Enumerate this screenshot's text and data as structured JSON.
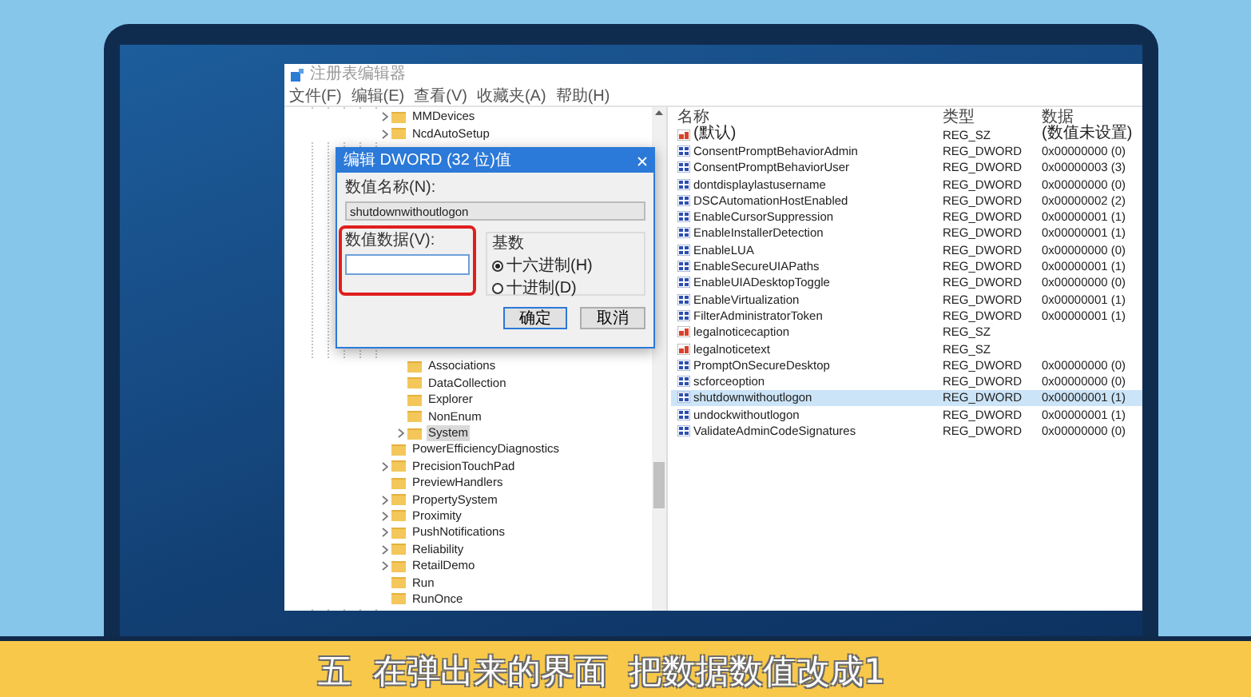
{
  "window": {
    "title": "注册表编辑器"
  },
  "menu": [
    "文件(F)",
    "编辑(E)",
    "查看(V)",
    "收藏夹(A)",
    "帮助(H)"
  ],
  "tree": {
    "items": [
      {
        "label": "MMDevices",
        "expandable": true,
        "selected": false
      },
      {
        "label": "NcdAutoSetup",
        "expandable": true,
        "selected": false
      },
      {
        "children": [
          {
            "label": "Associations",
            "expandable": false,
            "selected": false
          },
          {
            "label": "DataCollection",
            "expandable": false,
            "selected": false
          },
          {
            "label": "Explorer",
            "expandable": false,
            "selected": false
          },
          {
            "label": "NonEnum",
            "expandable": false,
            "selected": false
          },
          {
            "label": "System",
            "expandable": true,
            "selected": true
          }
        ]
      },
      {
        "label": "PowerEfficiencyDiagnostics",
        "expandable": false,
        "selected": false
      },
      {
        "label": "PrecisionTouchPad",
        "expandable": true,
        "selected": false
      },
      {
        "label": "PreviewHandlers",
        "expandable": false,
        "selected": false
      },
      {
        "label": "PropertySystem",
        "expandable": true,
        "selected": false
      },
      {
        "label": "Proximity",
        "expandable": true,
        "selected": false
      },
      {
        "label": "PushNotifications",
        "expandable": true,
        "selected": false
      },
      {
        "label": "Reliability",
        "expandable": true,
        "selected": false
      },
      {
        "label": "RetailDemo",
        "expandable": true,
        "selected": false
      },
      {
        "label": "Run",
        "expandable": false,
        "selected": false
      },
      {
        "label": "RunOnce",
        "expandable": false,
        "selected": false
      }
    ]
  },
  "values": {
    "columns": [
      "名称",
      "类型",
      "数据"
    ],
    "rows": [
      {
        "name": "(默认)",
        "kind": "sz",
        "type": "REG_SZ",
        "data": "(数值未设置)",
        "selected": false
      },
      {
        "name": "ConsentPromptBehaviorAdmin",
        "kind": "dword",
        "type": "REG_DWORD",
        "data": "0x00000000 (0)",
        "selected": false
      },
      {
        "name": "ConsentPromptBehaviorUser",
        "kind": "dword",
        "type": "REG_DWORD",
        "data": "0x00000003 (3)",
        "selected": false
      },
      {
        "name": "dontdisplaylastusername",
        "kind": "dword",
        "type": "REG_DWORD",
        "data": "0x00000000 (0)",
        "selected": false
      },
      {
        "name": "DSCAutomationHostEnabled",
        "kind": "dword",
        "type": "REG_DWORD",
        "data": "0x00000002 (2)",
        "selected": false
      },
      {
        "name": "EnableCursorSuppression",
        "kind": "dword",
        "type": "REG_DWORD",
        "data": "0x00000001 (1)",
        "selected": false
      },
      {
        "name": "EnableInstallerDetection",
        "kind": "dword",
        "type": "REG_DWORD",
        "data": "0x00000001 (1)",
        "selected": false
      },
      {
        "name": "EnableLUA",
        "kind": "dword",
        "type": "REG_DWORD",
        "data": "0x00000000 (0)",
        "selected": false
      },
      {
        "name": "EnableSecureUIAPaths",
        "kind": "dword",
        "type": "REG_DWORD",
        "data": "0x00000001 (1)",
        "selected": false
      },
      {
        "name": "EnableUIADesktopToggle",
        "kind": "dword",
        "type": "REG_DWORD",
        "data": "0x00000000 (0)",
        "selected": false
      },
      {
        "name": "EnableVirtualization",
        "kind": "dword",
        "type": "REG_DWORD",
        "data": "0x00000001 (1)",
        "selected": false
      },
      {
        "name": "FilterAdministratorToken",
        "kind": "dword",
        "type": "REG_DWORD",
        "data": "0x00000001 (1)",
        "selected": false
      },
      {
        "name": "legalnoticecaption",
        "kind": "sz",
        "type": "REG_SZ",
        "selected": false
      },
      {
        "name": "legalnoticetext",
        "kind": "sz",
        "type": "REG_SZ",
        "selected": false
      },
      {
        "name": "PromptOnSecureDesktop",
        "kind": "dword",
        "type": "REG_DWORD",
        "data": "0x00000000 (0)",
        "selected": false
      },
      {
        "name": "scforceoption",
        "kind": "dword",
        "type": "REG_DWORD",
        "data": "0x00000000 (0)",
        "selected": false
      },
      {
        "name": "shutdownwithoutlogon",
        "kind": "dword",
        "type": "REG_DWORD",
        "data": "0x00000001 (1)",
        "selected": true
      },
      {
        "name": "undockwithoutlogon",
        "kind": "dword",
        "type": "REG_DWORD",
        "data": "0x00000001 (1)",
        "selected": false
      },
      {
        "name": "ValidateAdminCodeSignatures",
        "kind": "dword",
        "type": "REG_DWORD",
        "data": "0x00000000 (0)",
        "selected": false
      }
    ]
  },
  "dialog": {
    "title": "编辑 DWORD (32 位)值",
    "value_name_label": "数值名称(N):",
    "value_name": "shutdownwithoutlogon",
    "value_data_label": "数值数据(V):",
    "highlighted": true,
    "base": {
      "label": "基数",
      "options": [
        {
          "label": "十六进制(H)",
          "selected": true
        },
        {
          "label": "十进制(D)",
          "selected": false
        }
      ]
    },
    "buttons": [
      {
        "label": "确定",
        "default": true
      },
      {
        "label": "取消",
        "default": false
      }
    ]
  },
  "caption": {
    "text": "五  在弹出来的界面  把数据数值改成1"
  }
}
